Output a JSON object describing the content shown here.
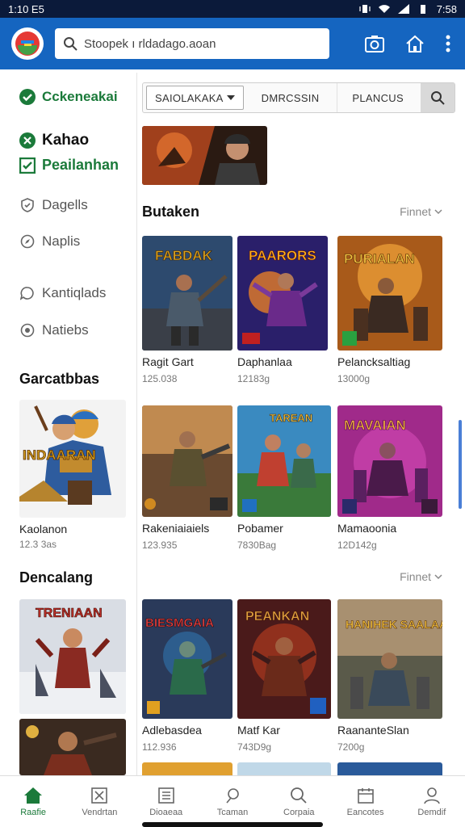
{
  "status": {
    "time": "1:10 E5",
    "clock": "7:58"
  },
  "header": {
    "search_text": "Stoopek ı rldadago.aoan",
    "icons": [
      "camera-icon",
      "home-icon",
      "more-vertical-icon"
    ]
  },
  "sidebar": {
    "items": [
      {
        "label": "Cckeneakai",
        "icon": "check-circle-icon"
      },
      {
        "label": "Kahao",
        "icon": "close-circle-icon"
      },
      {
        "label": "Peailanhan",
        "icon": "checkbox-icon"
      },
      {
        "label": "Dagells",
        "icon": "shield-icon"
      },
      {
        "label": "Naplis",
        "icon": "compass-icon"
      },
      {
        "label": "Kantiqlads",
        "icon": "chat-icon"
      },
      {
        "label": "Natiebs",
        "icon": "target-icon"
      }
    ],
    "heading1": "Garcatbbas",
    "card1": {
      "title": "Kaolanon",
      "sub": "12.3 3as",
      "art_text": "INDAARAN"
    },
    "heading2": "Dencalang",
    "card2": {
      "art_text": "TRENIAAN"
    }
  },
  "filters": {
    "f1": "SAIOLAKAKA",
    "f2": "DMRCSSIN",
    "f3": "PLANCUS"
  },
  "section1": {
    "title": "Butaken",
    "more": "Finnet"
  },
  "grid1": [
    {
      "title": "Ragit Gart",
      "sub": "125.038",
      "art": "FABDAK"
    },
    {
      "title": "Daphanlaa",
      "sub": "12183g",
      "art": "PAARORS"
    },
    {
      "title": "Pelancksaltiag",
      "sub": "13000g",
      "art": "PURIALAN"
    },
    {
      "title": "Rakeniaiaiels",
      "sub": "123.935",
      "art": ""
    },
    {
      "title": "Pobamer",
      "sub": "7830Bag",
      "art": "TAREAN"
    },
    {
      "title": "Mamaoonia",
      "sub": "12D142g",
      "art": "MAVAIAN"
    }
  ],
  "section2": {
    "more": "Finnet"
  },
  "grid2": [
    {
      "title": "Adlebasdea",
      "sub": "112.936",
      "art": "BIESMGAIA"
    },
    {
      "title": "Matf Kar",
      "sub": "743D9g",
      "art": "PEANKAN"
    },
    {
      "title": "RaananteSlan",
      "sub": "7200g",
      "art": "HANIHEK SAALAAN"
    }
  ],
  "bottom_nav": [
    {
      "label": "Raafie",
      "icon": "home-icon"
    },
    {
      "label": "Vendrtan",
      "icon": "store-icon"
    },
    {
      "label": "Dioaeaa",
      "icon": "library-icon"
    },
    {
      "label": "Tcaman",
      "icon": "location-icon"
    },
    {
      "label": "Corpaia",
      "icon": "search-icon"
    },
    {
      "label": "Eancotes",
      "icon": "calendar-icon"
    },
    {
      "label": "Demdif",
      "icon": "profile-icon"
    }
  ]
}
